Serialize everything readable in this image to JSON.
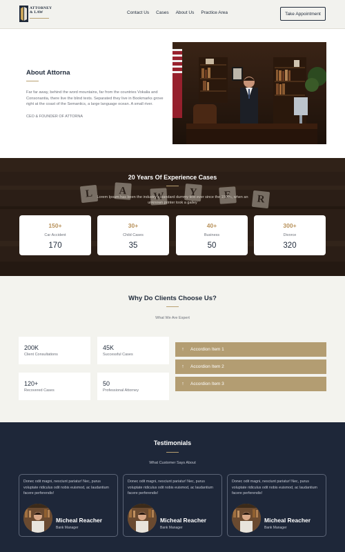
{
  "header": {
    "logo_text": [
      "ATTORNEY",
      "& LAW"
    ],
    "nav": [
      "Contact Us",
      "Cases",
      "About Us",
      "Practice Area"
    ],
    "appointment_button": "Take Appointment"
  },
  "about": {
    "title": "About Attorna",
    "body": "Far far away, behind the word mountains, far from the countries Vokalia and Consonantia, there live the blind texts. Separated they live in Bookmarks grove right at the coast of the Semantics, a large language ocean. A small river.",
    "signature": "CEO & FOUNDER OF ATTORNA"
  },
  "experience": {
    "title": "20 Years Of Experience Cases",
    "subtitle": "Lorem Ipsum has been the industry's standard dummy text ever since the 1500s, when an unknown printer took a galley",
    "tiles": [
      "L",
      "A",
      "W",
      "Y",
      "E",
      "R"
    ],
    "stats": [
      {
        "num": "150+",
        "label": "Car Accident",
        "value": "170"
      },
      {
        "num": "30+",
        "label": "Child Cases",
        "value": "35"
      },
      {
        "num": "40+",
        "label": "Business",
        "value": "50"
      },
      {
        "num": "300+",
        "label": "Divorce",
        "value": "320"
      }
    ]
  },
  "why": {
    "title": "Why Do Clients Choose Us?",
    "subtitle": "What We Are Expert",
    "stats": [
      {
        "num": "200K",
        "label": "Client Consultations"
      },
      {
        "num": "45K",
        "label": "Successful Cases"
      },
      {
        "num": "120+",
        "label": "Recovered Cases"
      },
      {
        "num": "50",
        "label": "Professional Attorney"
      }
    ],
    "accordion": [
      "Accordion Item 1",
      "Accordion Item 2",
      "Accordion Item 3"
    ]
  },
  "testimonials": {
    "title": "Testimonials",
    "subtitle": "What Customer Says About",
    "items": [
      {
        "text": "Donec odit magni, nesciunt pariatur! Nec, purus voluptate ridiculus odit nobis euismod, ac laudantium facere perferendis!",
        "name": "Micheal Reacher",
        "role": "Bank Manager"
      },
      {
        "text": "Donec odit magni, nesciunt pariatur! Nec, purus voluptate ridiculus odit nobis euismod, ac laudantium facere perferendis!",
        "name": "Micheal Reacher",
        "role": "Bank Manager"
      },
      {
        "text": "Donec odit magni, nesciunt pariatur! Nec, purus voluptate ridiculus odit nobis euismod, ac laudantium facere perferendis!",
        "name": "Micheal Reacher",
        "role": "Bank Manager"
      }
    ]
  },
  "colors": {
    "accent_gold": "#b39d72",
    "navy": "#1e2739",
    "light_bg": "#f3f3ee"
  }
}
